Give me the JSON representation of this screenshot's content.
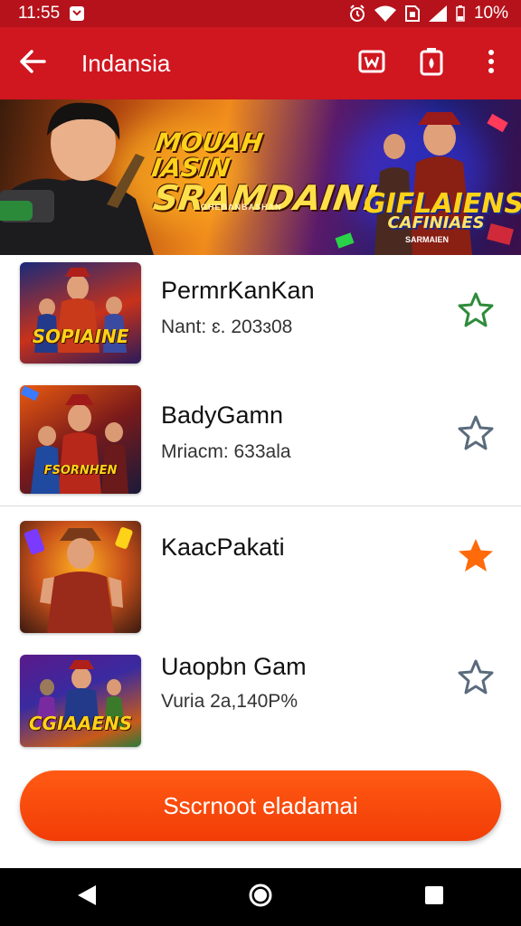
{
  "status_bar": {
    "time": "11:55",
    "battery": "10%",
    "icons": [
      "notification-icon",
      "alarm-icon",
      "wifi-icon",
      "sim-icon",
      "signal-icon",
      "battery-icon"
    ]
  },
  "app_bar": {
    "title": "Indansia",
    "icons": [
      "back-arrow-icon",
      "game-mode-icon",
      "battery-saver-icon",
      "more-vert-icon"
    ],
    "color": "#d0161f"
  },
  "banner": {
    "headline_line1": "MOUAH IASIN",
    "headline_line2": "SRAMDAIN!",
    "headline_sub": "GHEBANBASHAN",
    "logo_line1": "GIFLAIENS",
    "logo_line2": "CAFINIAES",
    "logo_sub": "SARMAIEN"
  },
  "games": [
    {
      "title": "PermrKanKan",
      "subtitle": "Nant: ɛ. 203ɜ08",
      "thumb_caption": "SOPIAINE",
      "favorited": false,
      "star_color": "#2e8b3a"
    },
    {
      "title": "BadyGamn",
      "subtitle": "Mriacm: 633ala",
      "thumb_caption": "FSORNHEN",
      "favorited": false,
      "star_color": "#5a6b7c"
    },
    {
      "title": "KaacPakati",
      "subtitle": "",
      "thumb_caption": "",
      "favorited": true,
      "star_color": "#ff6a0a"
    },
    {
      "title": "Uaopbn Gam",
      "subtitle": "Vuria 2a,140P%",
      "thumb_caption": "CGIAAENS",
      "favorited": false,
      "star_color": "#5a6b7c"
    }
  ],
  "cta": {
    "label": "Sscrnoot eladamai",
    "color": "#ff4a0a"
  },
  "nav_bar": {
    "icons": [
      "nav-back-icon",
      "nav-home-icon",
      "nav-recents-icon"
    ]
  }
}
